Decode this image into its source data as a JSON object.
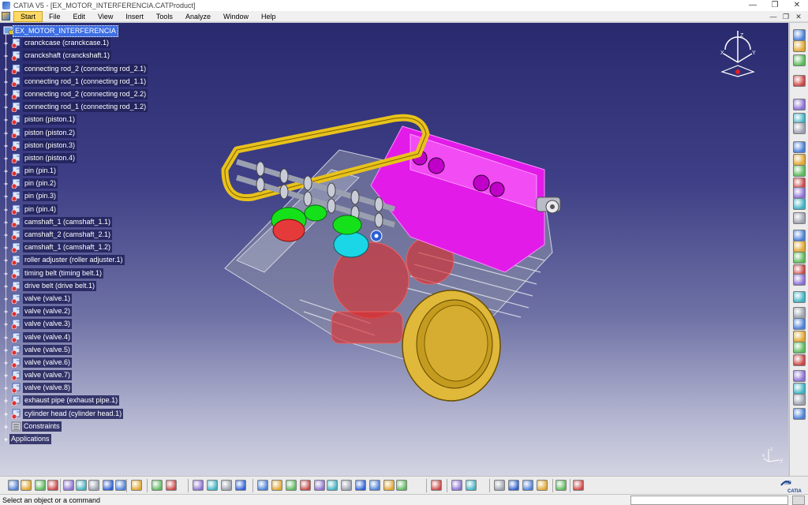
{
  "window": {
    "title": "CATIA V5 - [EX_MOTOR_INTERFERENCIA.CATProduct]",
    "controls": [
      "—",
      "❐",
      "✕"
    ]
  },
  "menubar": {
    "items": [
      "Start",
      "File",
      "Edit",
      "View",
      "Insert",
      "Tools",
      "Analyze",
      "Window",
      "Help"
    ],
    "mdi_controls": [
      "—",
      "❐",
      "✕"
    ]
  },
  "tree": {
    "root": "EX_MOTOR_INTERFERENCIA",
    "parts": [
      "cranckcase (cranckcase.1)",
      "cranckshaft (cranckshaft.1)",
      "connecting rod_2 (connecting rod_2.1)",
      "connecting rod_1 (connecting rod_1.1)",
      "connecting rod_2 (connecting rod_2.2)",
      "connecting rod_1 (connecting rod_1.2)",
      "piston (piston.1)",
      "piston (piston.2)",
      "piston (piston.3)",
      "piston (piston.4)",
      "pin (pin.1)",
      "pin (pin.2)",
      "pin (pin.3)",
      "pin (pin.4)",
      "camshaft_1 (camshaft_1.1)",
      "camshaft_2 (camshaft_2.1)",
      "camshaft_1 (camshaft_1.2)",
      "roller adjuster (roller adjuster.1)",
      "timing belt (timing belt.1)",
      "drive belt (drive belt.1)",
      "valve (valve.1)",
      "valve (valve.2)",
      "valve (valve.3)",
      "valve (valve.4)",
      "valve (valve.5)",
      "valve (valve.6)",
      "valve (valve.7)",
      "valve (valve.8)",
      "exhaust pipe (exhaust pipe.1)",
      "cylinder head (cylinder head.1)"
    ],
    "constraints": "Constraints",
    "applications": "Applications"
  },
  "compass": {
    "axes": [
      "X",
      "Y",
      "Z"
    ]
  },
  "axis_triad": {
    "axes": [
      "x",
      "y",
      "z"
    ]
  },
  "logo": {
    "text": "CATIA"
  },
  "status": {
    "message": "Select an object or a command",
    "command_value": ""
  },
  "colors": {
    "viewport_top": "#292a6e",
    "viewport_bottom": "#d3d4e2",
    "selection": "#3d6ee2",
    "cylinder_head": "#e21be8",
    "belt": "#e8c21c",
    "piston_green": "#15e11a",
    "piston_cyan": "#1ad6e6",
    "crankcase_red": "#d93030"
  },
  "icons": {
    "bottom_toolbar": [
      "new-icon",
      "open-icon",
      "save-icon",
      "print-icon",
      "cut-icon",
      "copy-icon",
      "paste-icon",
      "undo-icon",
      "redo-icon",
      "whats-this-icon",
      "formula-icon",
      "comment-icon",
      "table-icon",
      "catalog-icon",
      "knowledge-icon",
      "macro-icon",
      "fly-mode-icon",
      "fit-all-icon",
      "pan-icon",
      "rotate-icon",
      "zoom-in-icon",
      "zoom-out-icon",
      "normal-view-icon",
      "iso-view-icon",
      "view-mode-icon",
      "hide-show-icon",
      "swap-visible-icon",
      "camera-icon",
      "compass-icon",
      "measure-icon",
      "search-icon",
      "clash-icon",
      "sectioning-icon",
      "distance-icon",
      "update-icon",
      "catalog-browser-icon"
    ],
    "right_toolbar": [
      "product-structure-icon",
      "component-icon",
      "existing-component-icon",
      "replace-icon",
      "graph-tree-icon",
      "generate-numbering-icon",
      "manipulation-icon",
      "snap-icon",
      "explode-icon",
      "constraints-icon",
      "coincidence-icon",
      "contact-icon",
      "offset-icon",
      "angle-icon",
      "fix-icon",
      "fix-together-icon",
      "quick-constraint-icon",
      "flexible-icon",
      "reuse-pattern-icon",
      "space-analysis-icon",
      "clash-analysis-icon",
      "sectioning-analysis-icon",
      "distance-analysis-icon",
      "annotation-icon",
      "text-icon",
      "flag-note-icon",
      "scene-icon",
      "enhanced-scene-icon",
      "simulation-icon"
    ]
  }
}
